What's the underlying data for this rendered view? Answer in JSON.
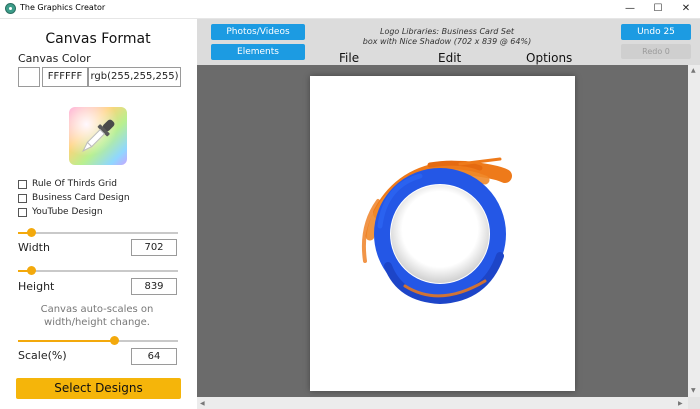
{
  "window": {
    "title": "The Graphics Creator",
    "controls": {
      "minimize": "—",
      "maximize": "☐",
      "close": "✕"
    }
  },
  "left_panel": {
    "title": "Canvas Format",
    "canvas_color_label": "Canvas Color",
    "hex_value": "FFFFFF",
    "rgb_value": "rgb(255,255,255)",
    "picker_icon": "color-picker-eyedropper",
    "checkboxes": [
      {
        "label": "Rule Of Thirds Grid",
        "checked": false
      },
      {
        "label": "Business Card Design",
        "checked": false
      },
      {
        "label": "YouTube Design",
        "checked": false
      }
    ],
    "width_label": "Width",
    "width_value": "702",
    "height_label": "Height",
    "height_value": "839",
    "note": "Canvas auto-scales on width/height change.",
    "scale_label": "Scale(%)",
    "scale_value": "64",
    "select_button": "Select Designs",
    "sliders": {
      "width_fraction": 0.08,
      "height_fraction": 0.08,
      "scale_fraction": 0.6
    }
  },
  "toolbar": {
    "photos_videos": "Photos/Videos",
    "elements": "Elements",
    "info_line1": "Logo Libraries: Business Card Set",
    "info_line2": "box with Nice Shadow (702 x 839 @ 64%)",
    "menu": [
      "File",
      "Edit",
      "Options"
    ],
    "undo": "Undo 25",
    "redo": "Redo 0"
  },
  "colors": {
    "accent_orange": "#f3a90c",
    "button_blue": "#1c9be2",
    "workspace_gray": "#6b6b6b",
    "brush_blue": "#2457e6",
    "brush_orange": "#ee7a1a"
  }
}
